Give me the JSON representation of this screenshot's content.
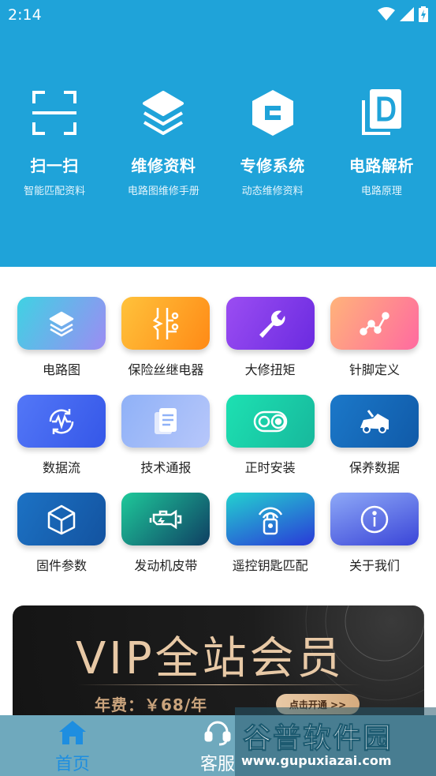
{
  "status_bar": {
    "time": "2:14",
    "icons": [
      "wifi-icon",
      "signal-icon",
      "battery-charging-icon"
    ]
  },
  "top_features": [
    {
      "title": "扫一扫",
      "subtitle": "智能匹配资料",
      "icon": "scan-icon"
    },
    {
      "title": "维修资料",
      "subtitle": "电路图维修手册",
      "icon": "layers-icon"
    },
    {
      "title": "专修系统",
      "subtitle": "动态维修资料",
      "icon": "hexagon-e-icon"
    },
    {
      "title": "电路解析",
      "subtitle": "电路原理",
      "icon": "document-d-icon"
    }
  ],
  "grid": [
    {
      "label": "电路图",
      "icon": "layers-icon",
      "colors": [
        "#3fd2e3",
        "#9c8cf3"
      ]
    },
    {
      "label": "保险丝继电器",
      "icon": "fuse-relay-icon",
      "colors": [
        "#ffc23b",
        "#ff8a16"
      ]
    },
    {
      "label": "大修扭矩",
      "icon": "wrench-icon",
      "colors": [
        "#9b4df2",
        "#6b2be0"
      ]
    },
    {
      "label": "针脚定义",
      "icon": "pin-nodes-icon",
      "colors": [
        "#ffb37a",
        "#ff6aa0"
      ]
    },
    {
      "label": "数据流",
      "icon": "data-flow-icon",
      "colors": [
        "#5377f7",
        "#3557e8"
      ]
    },
    {
      "label": "技术通报",
      "icon": "bulletin-icon",
      "colors": [
        "#8fb1f7",
        "#b7c7fa"
      ]
    },
    {
      "label": "正时安装",
      "icon": "timing-belt-icon",
      "colors": [
        "#1de1b2",
        "#17b89c"
      ]
    },
    {
      "label": "保养数据",
      "icon": "car-maintenance-icon",
      "colors": [
        "#1b78c9",
        "#105aa8"
      ]
    },
    {
      "label": "固件参数",
      "icon": "cube-icon",
      "colors": [
        "#1c72c4",
        "#1353a0"
      ]
    },
    {
      "label": "发动机皮带",
      "icon": "engine-icon",
      "colors": [
        "#1ec99a",
        "#0f3f63"
      ]
    },
    {
      "label": "遥控钥匙匹配",
      "icon": "remote-key-icon",
      "colors": [
        "#23d2cf",
        "#2a39d8"
      ]
    },
    {
      "label": "关于我们",
      "icon": "info-icon",
      "colors": [
        "#8ea9f7",
        "#3a45d8"
      ]
    }
  ],
  "vip": {
    "title": "VIP全站会员",
    "price": "年费：￥68/年",
    "button": "点击开通 >>"
  },
  "tabbar": {
    "home": "首页",
    "service": "客服"
  },
  "watermark": {
    "name": "谷普软件园",
    "url": "www.gupuxiazai.com"
  },
  "colors": {
    "header": "#1fa3d9",
    "tab_active": "#1e8ee0",
    "vip_gold": "#e8c9a6"
  }
}
